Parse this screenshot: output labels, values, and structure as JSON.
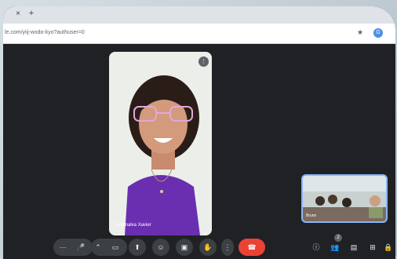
{
  "browser": {
    "tab_close": "×",
    "tab_new": "+",
    "url": "le.com/yiij-wxdo-kyo?authuser=0",
    "star_icon": "★",
    "profile_initial": "G"
  },
  "call": {
    "main_participant_name": "Lindinalva Xavier",
    "self_label": "Bruno",
    "participants_count": "2"
  },
  "toolbar": {
    "more_left": "⋯",
    "mic_icon": "🎤",
    "chevron_mic": "⌃",
    "chevron_cam": "⌃",
    "camera_icon": "▭",
    "present_icon": "⬆",
    "emoji_icon": "☺",
    "captions_icon": "▣",
    "hand_icon": "✋",
    "more_icon": "⋮",
    "end_call_icon": "☎",
    "info_icon": "ⓘ",
    "people_icon": "👥",
    "chat_icon": "▤",
    "activities_icon": "⊞",
    "lock_icon": "🔒"
  },
  "colors": {
    "end_call": "#ea4335",
    "self_border": "#8ab4f8",
    "background": "#202124"
  }
}
